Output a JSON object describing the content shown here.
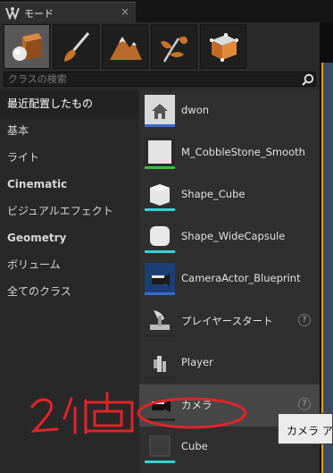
{
  "window": {
    "tab_title": "モード",
    "close_glyph": "×"
  },
  "mode_buttons": [
    {
      "name": "place-mode",
      "icon": "box-sphere-icon",
      "active": true
    },
    {
      "name": "paint-mode",
      "icon": "paintbrush-icon",
      "active": false
    },
    {
      "name": "landscape-mode",
      "icon": "mountain-icon",
      "active": false
    },
    {
      "name": "foliage-mode",
      "icon": "leaf-icon",
      "active": false
    },
    {
      "name": "geometry-mode",
      "icon": "cube-edit-icon",
      "active": false
    }
  ],
  "search": {
    "placeholder": "クラスの検索",
    "value": ""
  },
  "categories": [
    {
      "label": "最近配置したもの",
      "selected": true,
      "bold": false
    },
    {
      "label": "基本",
      "selected": false,
      "bold": false
    },
    {
      "label": "ライト",
      "selected": false,
      "bold": false
    },
    {
      "label": "Cinematic",
      "selected": false,
      "bold": true
    },
    {
      "label": "ビジュアルエフェクト",
      "selected": false,
      "bold": false
    },
    {
      "label": "Geometry",
      "selected": false,
      "bold": true
    },
    {
      "label": "ボリューム",
      "selected": false,
      "bold": false
    },
    {
      "label": "全てのクラス",
      "selected": false,
      "bold": false
    }
  ],
  "items": [
    {
      "label": "dwon",
      "thumb": "house-icon",
      "bar_color": "#3a6ad0",
      "help": false,
      "highlighted": false
    },
    {
      "label": "M_CobbleStone_Smooth",
      "thumb": "material-icon",
      "bar_color": "#3bbf3b",
      "help": false,
      "highlighted": false
    },
    {
      "label": "Shape_Cube",
      "thumb": "cube-icon",
      "bar_color": "#2fd4d4",
      "help": false,
      "highlighted": false
    },
    {
      "label": "Shape_WideCapsule",
      "thumb": "capsule-icon",
      "bar_color": "#2fd4d4",
      "help": false,
      "highlighted": false
    },
    {
      "label": "CameraActor_Blueprint",
      "thumb": "camera-blueprint-icon",
      "bar_color": "#3a6ad0",
      "help": false,
      "highlighted": false
    },
    {
      "label": "プレイヤースタート",
      "thumb": "player-start-icon",
      "bar_color": "#2a2a2a",
      "help": true,
      "highlighted": false
    },
    {
      "label": "Player",
      "thumb": "player-icon",
      "bar_color": "#2a2a2a",
      "help": false,
      "highlighted": false
    },
    {
      "label": "カメラ",
      "thumb": "camera-icon",
      "bar_color": "#2a2a2a",
      "help": true,
      "highlighted": true
    },
    {
      "label": "Cube",
      "thumb": "cube-dark-icon",
      "bar_color": "#2fd4d4",
      "help": false,
      "highlighted": false
    }
  ],
  "help_glyph": "?",
  "tooltip": {
    "text": "カメラ ア"
  },
  "annotation": {
    "text": "2個",
    "color": "#e0242a"
  }
}
